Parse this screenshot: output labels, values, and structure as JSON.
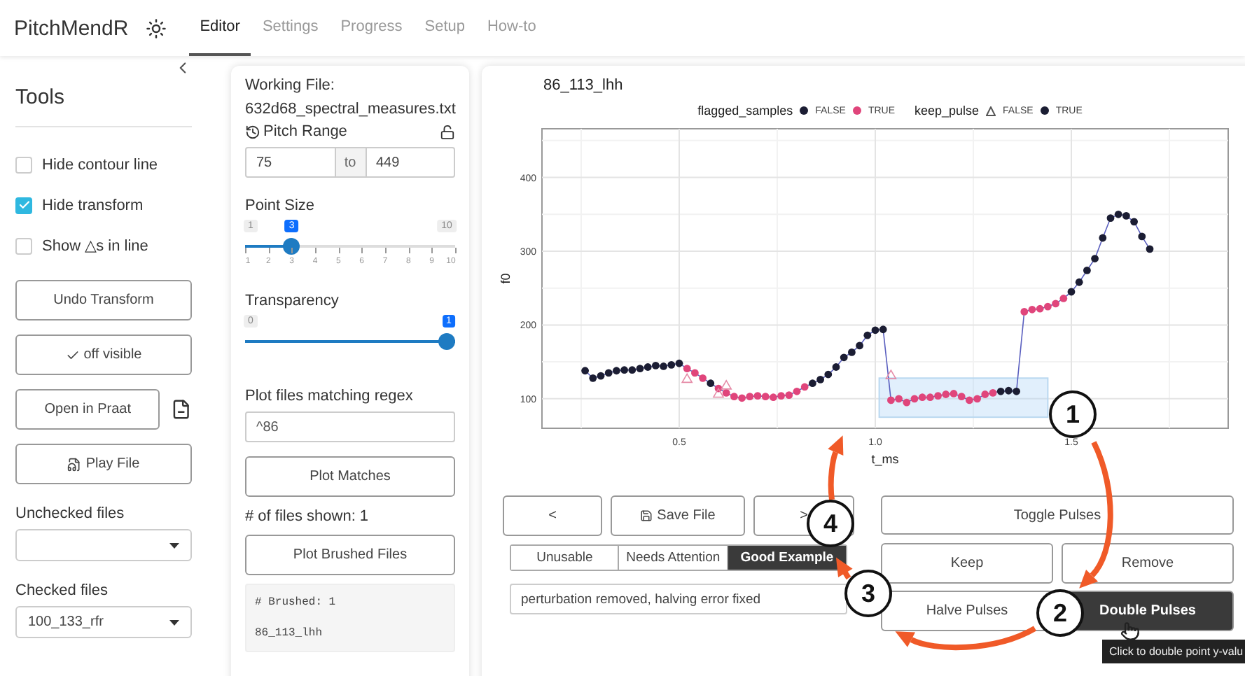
{
  "app": {
    "brand": "PitchMendR"
  },
  "nav_tabs": [
    {
      "label": "Editor",
      "selected": true
    },
    {
      "label": "Settings",
      "selected": false
    },
    {
      "label": "Progress",
      "selected": false
    },
    {
      "label": "Setup",
      "selected": false
    },
    {
      "label": "How-to",
      "selected": false
    }
  ],
  "sidebar": {
    "title": "Tools",
    "checkboxes": [
      {
        "label": "Hide contour line",
        "checked": false
      },
      {
        "label": "Hide transform",
        "checked": true
      },
      {
        "label": "Show △s in line",
        "checked": false
      }
    ],
    "buttons": [
      {
        "label": "Undo Transform",
        "kind": "plain"
      },
      {
        "label": "off visible",
        "kind": "check"
      },
      {
        "label": "Open in Praat",
        "kind": "praat"
      },
      {
        "label": "Play File",
        "kind": "file"
      }
    ],
    "selects": [
      {
        "label": "Unchecked files"
      },
      {
        "label": "Checked files",
        "value": "100_133_rfr"
      }
    ]
  },
  "file_panel": {
    "working_label": "Working File:",
    "working_file": "632d68_spectral_measures.txt",
    "pitch_range": {
      "label": "Pitch Range",
      "from": "75",
      "sep": "to",
      "to": "449",
      "locked": false
    },
    "sliders": [
      {
        "label": "Point Size",
        "min": "1",
        "max": "10",
        "value": "3",
        "level": 0.222,
        "ticks": [
          "1",
          "2",
          "3",
          "4",
          "5",
          "6",
          "7",
          "8",
          "9",
          "10"
        ]
      },
      {
        "label": "Transparency",
        "min": "0",
        "value": "1",
        "level": 1
      }
    ],
    "regex": {
      "label": "Plot files matching regex",
      "value": "^86"
    },
    "plot_button": "Plot Matches",
    "files_shown": "# of files shown: 1",
    "brushed_button": "Plot Brushed Files",
    "output": [
      "# Brushed: 1",
      "86_113_lhh"
    ]
  },
  "plot_panel": {
    "title": "86_113_lhh",
    "legend": [
      {
        "title": "flagged_samples",
        "items": [
          {
            "label": "FALSE",
            "kind": "dot",
            "color": "#1b1d33"
          },
          {
            "label": "TRUE",
            "kind": "dot",
            "color": "#e0457b"
          }
        ]
      },
      {
        "title": "keep_pulse",
        "items": [
          {
            "label": "FALSE",
            "kind": "triangle",
            "color": "#555555"
          },
          {
            "label": "TRUE",
            "kind": "dot",
            "color": "#1b1d33"
          }
        ]
      }
    ],
    "brush_active": true,
    "chart_data": {
      "type": "scatter",
      "grid": true,
      "xlabel": "t_ms",
      "ylabel": "f0",
      "xlim": [
        0.15,
        1.9
      ],
      "ylim": [
        60,
        466
      ],
      "xticks": [
        {
          "value": 0.5,
          "label": "0.5"
        },
        {
          "value": 1.0,
          "label": "1.0"
        },
        {
          "value": 1.5,
          "label": "1.5"
        }
      ],
      "yticks": [
        100,
        200,
        300,
        400
      ],
      "x": [
        0.26,
        0.28,
        0.3,
        0.32,
        0.34,
        0.36,
        0.38,
        0.4,
        0.42,
        0.44,
        0.46,
        0.48,
        0.5,
        0.52,
        0.54,
        0.56,
        0.58,
        0.6,
        0.62,
        0.64,
        0.66,
        0.68,
        0.7,
        0.72,
        0.74,
        0.76,
        0.78,
        0.8,
        0.82,
        0.84,
        0.86,
        0.88,
        0.9,
        0.92,
        0.94,
        0.96,
        0.98,
        1.0,
        1.02,
        1.04,
        1.06,
        1.08,
        1.1,
        1.12,
        1.14,
        1.16,
        1.18,
        1.2,
        1.22,
        1.24,
        1.26,
        1.28,
        1.3,
        1.32,
        1.34,
        1.36,
        1.38,
        1.4,
        1.42,
        1.44,
        1.46,
        1.48,
        1.5,
        1.52,
        1.54,
        1.56,
        1.58,
        1.6,
        1.62,
        1.64,
        1.66,
        1.68,
        1.7
      ],
      "series": [
        {
          "type": "line",
          "color": "#5a5fbf",
          "values": [
            138,
            128,
            131,
            135,
            138,
            139,
            139,
            141,
            143,
            145,
            144,
            146,
            148,
            141,
            135,
            128,
            121,
            114,
            108,
            103,
            101,
            103,
            104,
            103,
            102,
            104,
            105,
            110,
            116,
            121,
            126,
            133,
            143,
            156,
            163,
            172,
            186,
            193,
            194,
            98,
            100,
            95,
            100,
            102,
            102,
            104,
            106,
            107,
            103,
            98,
            100,
            106,
            108,
            110,
            111,
            110,
            218,
            221,
            222,
            225,
            229,
            236,
            245,
            258,
            274,
            290,
            318,
            345,
            350,
            348,
            340,
            320,
            303
          ]
        },
        {
          "color": "#1b1d33",
          "values": [
            138,
            128,
            131,
            135,
            138,
            139,
            139,
            141,
            143,
            145,
            144,
            146,
            148,
            null,
            null,
            null,
            121,
            null,
            null,
            null,
            null,
            null,
            null,
            null,
            null,
            null,
            null,
            null,
            null,
            121,
            126,
            133,
            143,
            156,
            163,
            172,
            186,
            193,
            194,
            null,
            null,
            null,
            null,
            null,
            null,
            null,
            null,
            null,
            null,
            null,
            null,
            null,
            null,
            110,
            111,
            110,
            null,
            null,
            null,
            null,
            null,
            null,
            245,
            258,
            274,
            290,
            318,
            345,
            350,
            348,
            340,
            320,
            303
          ]
        },
        {
          "color": "#e0457b",
          "values": [
            null,
            null,
            null,
            null,
            null,
            null,
            null,
            null,
            null,
            null,
            null,
            null,
            null,
            141,
            135,
            128,
            null,
            114,
            108,
            103,
            101,
            103,
            104,
            103,
            102,
            104,
            105,
            110,
            116,
            null,
            null,
            null,
            null,
            null,
            null,
            null,
            null,
            null,
            null,
            98,
            100,
            95,
            100,
            102,
            102,
            104,
            106,
            107,
            103,
            98,
            100,
            106,
            108,
            null,
            null,
            null,
            218,
            221,
            222,
            225,
            229,
            236,
            null,
            null,
            null,
            null,
            null,
            null,
            null,
            null,
            null,
            null,
            null
          ]
        },
        {
          "marker": "triangle",
          "color": "#e58aa6",
          "values": [
            null,
            null,
            null,
            null,
            null,
            null,
            null,
            null,
            null,
            null,
            null,
            null,
            null,
            127,
            null,
            null,
            null,
            107,
            118,
            null,
            null,
            null,
            null,
            null,
            null,
            null,
            null,
            null,
            null,
            null,
            null,
            null,
            null,
            null,
            null,
            null,
            null,
            null,
            null,
            132,
            null,
            null,
            null,
            null,
            null,
            null,
            null,
            null,
            null,
            null,
            null,
            null,
            null,
            null,
            null,
            null,
            null,
            null,
            null,
            null,
            null,
            null,
            null,
            null,
            null,
            null,
            null,
            null,
            null,
            null,
            null,
            null,
            null
          ]
        }
      ]
    },
    "nav_buttons": [
      {
        "label": "<",
        "kind": "text"
      },
      {
        "label": "Save File",
        "kind": "save"
      },
      {
        "label": ">",
        "kind": "text"
      }
    ],
    "ratings": [
      {
        "label": "Unusable",
        "selected": false
      },
      {
        "label": "Needs Attention",
        "selected": false
      },
      {
        "label": "Good Example",
        "selected": true
      }
    ],
    "notes": "perturbation removed, halving error fixed",
    "pulse_buttons": [
      {
        "label": "Toggle Pulses",
        "active": false
      },
      {
        "label": "Keep",
        "active": false
      },
      {
        "label": "Remove",
        "active": false
      },
      {
        "label": "Halve Pulses",
        "active": false
      },
      {
        "label": "Double Pulses",
        "active": true
      }
    ],
    "tooltip": "Click to double point y-valu"
  },
  "callouts": [
    {
      "label": "1"
    },
    {
      "label": "2"
    },
    {
      "label": "3"
    },
    {
      "label": "4"
    }
  ]
}
